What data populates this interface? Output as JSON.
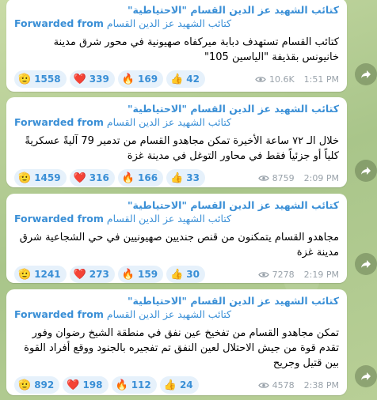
{
  "messages": [
    {
      "channel": "كتائب الشهيد عز الدين القسام \"الاحتياطية\"",
      "forward_label": "Forwarded from",
      "forward_source": "كتائب الشهيد عز الدين القسام",
      "text": "كتائب القسام تستهدف دبابة ميركفاه صهيونية في محور شرق مدينة خانيونس بقذيفة \"الياسين 105\"",
      "reactions": [
        {
          "emoji": "🫡",
          "count": "1558"
        },
        {
          "emoji": "❤️",
          "count": "339"
        },
        {
          "emoji": "🔥",
          "count": "169"
        },
        {
          "emoji": "👍",
          "count": "42"
        }
      ],
      "views": "10.6K",
      "time": "1:51 PM"
    },
    {
      "channel": "كتائب الشهيد عز الدين القسام \"الاحتياطية\"",
      "forward_label": "Forwarded from",
      "forward_source": "كتائب الشهيد عز الدين القسام",
      "text": "خلال الـ ٧٢ ساعة الأخيرة تمكن مجاهدو القسام من تدمير 79 آليةً عسكريةً كلياً أو جزئياً فقط في محاور التوغل في مدينة غزة",
      "reactions": [
        {
          "emoji": "🫡",
          "count": "1459"
        },
        {
          "emoji": "❤️",
          "count": "316"
        },
        {
          "emoji": "🔥",
          "count": "166"
        },
        {
          "emoji": "👍",
          "count": "33"
        }
      ],
      "views": "8759",
      "time": "2:09 PM"
    },
    {
      "channel": "كتائب الشهيد عز الدين القسام \"الاحتياطية\"",
      "forward_label": "Forwarded from",
      "forward_source": "كتائب الشهيد عز الدين القسام",
      "text": "مجاهدو القسام يتمكنون من قنص جنديين صهيونيين في حي الشجاعية شرق مدينة غزة",
      "reactions": [
        {
          "emoji": "🫡",
          "count": "1241"
        },
        {
          "emoji": "❤️",
          "count": "273"
        },
        {
          "emoji": "🔥",
          "count": "159"
        },
        {
          "emoji": "👍",
          "count": "30"
        }
      ],
      "views": "7278",
      "time": "2:19 PM"
    },
    {
      "channel": "كتائب الشهيد عز الدين القسام \"الاحتياطية\"",
      "forward_label": "Forwarded from",
      "forward_source": "كتائب الشهيد عز الدين القسام",
      "text": "تمكن مجاهدو القسام من تفخيخ عين نفق في منطقة الشيخ رضوان وفور تقدم قوة من جيش الاحتلال لعين النفق تم تفجيره بالجنود ووقع أفراد القوة بين قتيل وجريح",
      "reactions": [
        {
          "emoji": "🫡",
          "count": "892"
        },
        {
          "emoji": "❤️",
          "count": "198"
        },
        {
          "emoji": "🔥",
          "count": "112"
        },
        {
          "emoji": "👍",
          "count": "24"
        }
      ],
      "views": "4578",
      "time": "2:38 PM"
    }
  ]
}
